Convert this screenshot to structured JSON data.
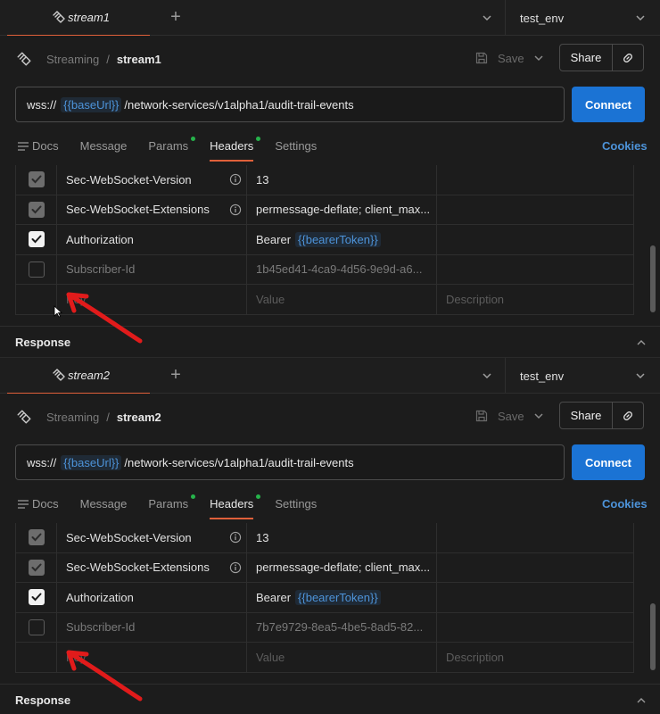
{
  "colors": {
    "accent": "#e0603a",
    "link": "#4d93d9",
    "connect": "#1b73d4",
    "status_dot": "#26b34b",
    "annotation": "#e11b1b"
  },
  "panels": [
    {
      "tab_name": "stream1",
      "environment": "test_env",
      "breadcrumb_parent": "Streaming",
      "breadcrumb_sep": "/",
      "breadcrumb_current": "stream1",
      "save_label": "Save",
      "share_label": "Share",
      "url_prefix": "wss://",
      "url_var": "{{baseUrl}}",
      "url_path": "/network-services/v1alpha1/audit-trail-events",
      "connect_label": "Connect",
      "tabs": {
        "docs": "Docs",
        "message": "Message",
        "params": "Params",
        "headers": "Headers",
        "settings": "Settings"
      },
      "cookies_label": "Cookies",
      "headers": [
        {
          "state": "disabled-on",
          "key": "Sec-WebSocket-Version",
          "value": "13",
          "info": true
        },
        {
          "state": "disabled-on",
          "key": "Sec-WebSocket-Extensions",
          "value": "permessage-deflate; client_max...",
          "info": true
        },
        {
          "state": "on",
          "key": "Authorization",
          "value_prefix": "Bearer",
          "value_var": "{{bearerToken}}"
        },
        {
          "state": "off",
          "key": "Subscriber-Id",
          "value": "1b45ed41-4ca9-4d56-9e9d-a6..."
        }
      ],
      "placeholder": {
        "key": "Key",
        "value": "Value",
        "description": "Description"
      },
      "response_label": "Response"
    },
    {
      "tab_name": "stream2",
      "environment": "test_env",
      "breadcrumb_parent": "Streaming",
      "breadcrumb_sep": "/",
      "breadcrumb_current": "stream2",
      "save_label": "Save",
      "share_label": "Share",
      "url_prefix": "wss://",
      "url_var": "{{baseUrl}}",
      "url_path": "/network-services/v1alpha1/audit-trail-events",
      "connect_label": "Connect",
      "tabs": {
        "docs": "Docs",
        "message": "Message",
        "params": "Params",
        "headers": "Headers",
        "settings": "Settings"
      },
      "cookies_label": "Cookies",
      "headers": [
        {
          "state": "disabled-on",
          "key": "Sec-WebSocket-Version",
          "value": "13",
          "info": true
        },
        {
          "state": "disabled-on",
          "key": "Sec-WebSocket-Extensions",
          "value": "permessage-deflate; client_max...",
          "info": true
        },
        {
          "state": "on",
          "key": "Authorization",
          "value_prefix": "Bearer",
          "value_var": "{{bearerToken}}"
        },
        {
          "state": "off",
          "key": "Subscriber-Id",
          "value": "7b7e9729-8ea5-4be5-8ad5-82..."
        }
      ],
      "placeholder": {
        "key": "Key",
        "value": "Value",
        "description": "Description"
      },
      "response_label": "Response"
    }
  ]
}
